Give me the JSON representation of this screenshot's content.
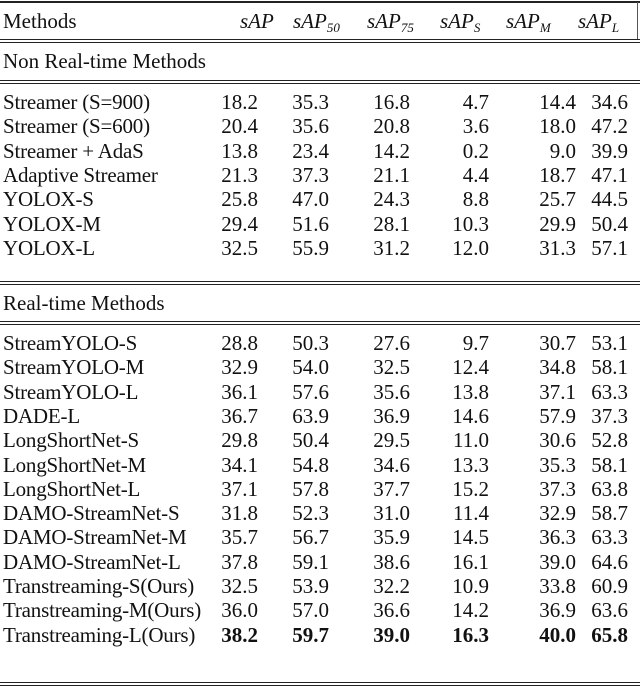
{
  "table": {
    "header": {
      "method": "Methods",
      "columns": [
        {
          "base": "sAP",
          "sub": ""
        },
        {
          "base": "sAP",
          "sub": "50"
        },
        {
          "base": "sAP",
          "sub": "75"
        },
        {
          "base": "sAP",
          "sub": "S"
        },
        {
          "base": "sAP",
          "sub": "M"
        },
        {
          "base": "sAP",
          "sub": "L"
        }
      ]
    },
    "sections": [
      {
        "title": "Non Real-time Methods",
        "rows": [
          {
            "method": "Streamer (S=900)",
            "values": [
              "18.2",
              "35.3",
              "16.8",
              "4.7",
              "14.4",
              "34.6"
            ]
          },
          {
            "method": "Streamer (S=600)",
            "values": [
              "20.4",
              "35.6",
              "20.8",
              "3.6",
              "18.0",
              "47.2"
            ]
          },
          {
            "method": "Streamer + AdaS",
            "values": [
              "13.8",
              "23.4",
              "14.2",
              "0.2",
              "9.0",
              "39.9"
            ]
          },
          {
            "method": "Adaptive Streamer",
            "values": [
              "21.3",
              "37.3",
              "21.1",
              "4.4",
              "18.7",
              "47.1"
            ]
          },
          {
            "method": "YOLOX-S",
            "values": [
              "25.8",
              "47.0",
              "24.3",
              "8.8",
              "25.7",
              "44.5"
            ]
          },
          {
            "method": "YOLOX-M",
            "values": [
              "29.4",
              "51.6",
              "28.1",
              "10.3",
              "29.9",
              "50.4"
            ]
          },
          {
            "method": "YOLOX-L",
            "values": [
              "32.5",
              "55.9",
              "31.2",
              "12.0",
              "31.3",
              "57.1"
            ]
          }
        ]
      },
      {
        "title": "Real-time Methods",
        "rows": [
          {
            "method": "StreamYOLO-S",
            "values": [
              "28.8",
              "50.3",
              "27.6",
              "9.7",
              "30.7",
              "53.1"
            ]
          },
          {
            "method": "StreamYOLO-M",
            "values": [
              "32.9",
              "54.0",
              "32.5",
              "12.4",
              "34.8",
              "58.1"
            ]
          },
          {
            "method": "StreamYOLO-L",
            "values": [
              "36.1",
              "57.6",
              "35.6",
              "13.8",
              "37.1",
              "63.3"
            ]
          },
          {
            "method": "DADE-L",
            "values": [
              "36.7",
              "63.9",
              "36.9",
              "14.6",
              "57.9",
              "37.3"
            ]
          },
          {
            "method": "LongShortNet-S",
            "values": [
              "29.8",
              "50.4",
              "29.5",
              "11.0",
              "30.6",
              "52.8"
            ]
          },
          {
            "method": "LongShortNet-M",
            "values": [
              "34.1",
              "54.8",
              "34.6",
              "13.3",
              "35.3",
              "58.1"
            ]
          },
          {
            "method": "LongShortNet-L",
            "values": [
              "37.1",
              "57.8",
              "37.7",
              "15.2",
              "37.3",
              "63.8"
            ]
          },
          {
            "method": "DAMO-StreamNet-S",
            "values": [
              "31.8",
              "52.3",
              "31.0",
              "11.4",
              "32.9",
              "58.7"
            ]
          },
          {
            "method": "DAMO-StreamNet-M",
            "values": [
              "35.7",
              "56.7",
              "35.9",
              "14.5",
              "36.3",
              "63.3"
            ]
          },
          {
            "method": "DAMO-StreamNet-L",
            "values": [
              "37.8",
              "59.1",
              "38.6",
              "16.1",
              "39.0",
              "64.6"
            ]
          },
          {
            "method": "Transtreaming-S(Ours)",
            "values": [
              "32.5",
              "53.9",
              "32.2",
              "10.9",
              "33.8",
              "60.9"
            ]
          },
          {
            "method": "Transtreaming-M(Ours)",
            "values": [
              "36.0",
              "57.0",
              "36.6",
              "14.2",
              "36.9",
              "63.6"
            ]
          },
          {
            "method": "Transtreaming-L(Ours)",
            "values": [
              "38.2",
              "59.7",
              "39.0",
              "16.3",
              "40.0",
              "65.8"
            ],
            "bold": true
          }
        ]
      }
    ]
  }
}
